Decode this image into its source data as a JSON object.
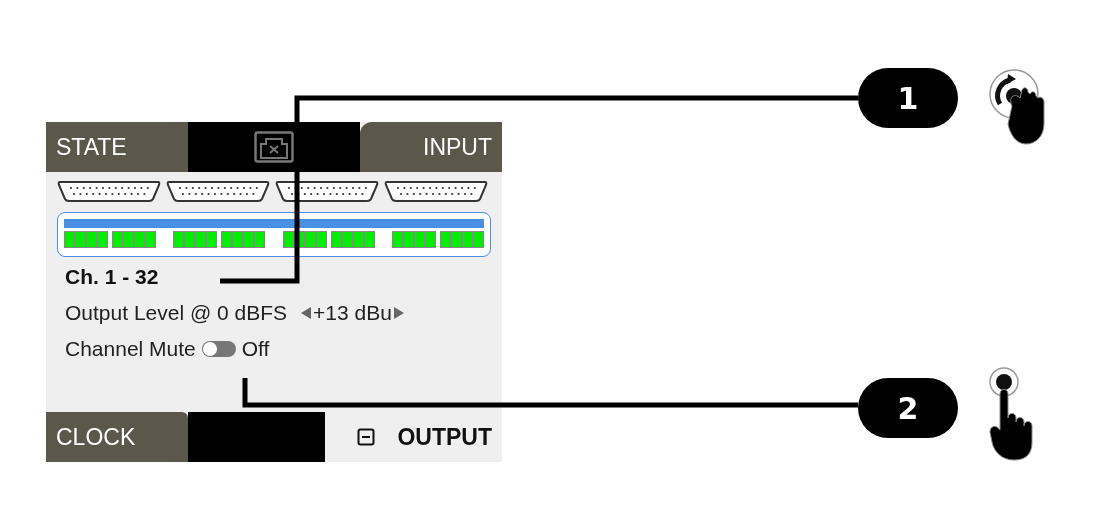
{
  "screen": {
    "top_tabs": [
      {
        "label": "STATE",
        "selected": false
      },
      {
        "label": "INPUT",
        "selected": false
      }
    ],
    "meter": {
      "level": 1
    },
    "section": "Ch. 1 - 32",
    "settings": [
      {
        "kind": "stepper",
        "label": "Output Level @ 0 dBFS",
        "value": "+13 dBu"
      },
      {
        "kind": "toggle",
        "label": "Channel Mute",
        "on": false,
        "value": "Off"
      }
    ],
    "bottom_tabs": [
      {
        "label": "CLOCK",
        "selected": false
      },
      {
        "label": "OUTPUT",
        "selected": true
      }
    ]
  },
  "callouts": [
    {
      "number": "1",
      "kind": "rotate"
    },
    {
      "number": "2",
      "kind": "tap"
    }
  ]
}
